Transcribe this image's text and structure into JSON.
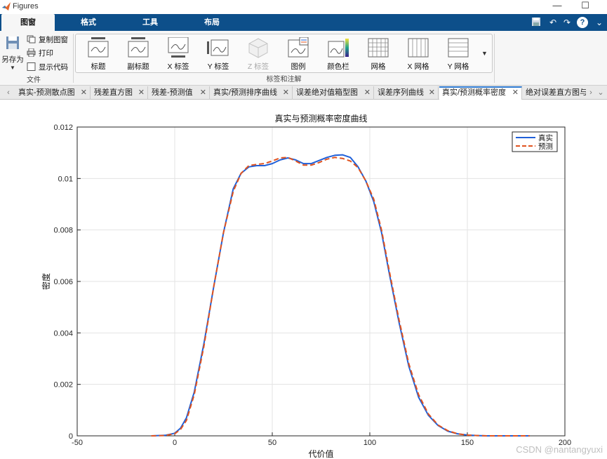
{
  "window": {
    "title": "Figures",
    "minimize": "—",
    "maximize": "☐"
  },
  "ribbon_tabs": [
    "图窗",
    "格式",
    "工具",
    "布局"
  ],
  "active_ribbon_tab": 0,
  "quick_access": [
    "save-icon",
    "undo-icon",
    "redo-icon",
    "help-icon",
    "expand-icon"
  ],
  "file_group": {
    "save_as": "另存为",
    "copy_figure": "复制图窗",
    "print": "打印",
    "show_code": "显示代码",
    "label": "文件"
  },
  "labels_group": {
    "label": "标签和注解",
    "buttons": [
      {
        "label": "标题",
        "icon": "title-icon",
        "enabled": true
      },
      {
        "label": "副标题",
        "icon": "subtitle-icon",
        "enabled": true
      },
      {
        "label": "X 标签",
        "icon": "xlabel-icon",
        "enabled": true
      },
      {
        "label": "Y 标签",
        "icon": "ylabel-icon",
        "enabled": true
      },
      {
        "label": "Z 标签",
        "icon": "zlabel-icon",
        "enabled": false
      },
      {
        "label": "图例",
        "icon": "legend-icon",
        "enabled": true
      },
      {
        "label": "颜色栏",
        "icon": "colorbar-icon",
        "enabled": true
      },
      {
        "label": "网格",
        "icon": "grid-icon",
        "enabled": true
      },
      {
        "label": "X 网格",
        "icon": "xgrid-icon",
        "enabled": true
      },
      {
        "label": "Y 网格",
        "icon": "ygrid-icon",
        "enabled": true
      }
    ]
  },
  "doc_tabs": [
    "真实-预测散点图",
    "残差直方图",
    "残差-预测值",
    "真实/预测排序曲线",
    "误差绝对值箱型图",
    "误差序列曲线",
    "真实/预测概率密度",
    "绝对误差直方图与"
  ],
  "active_doc_tab": 6,
  "watermark": "CSDN @nantangyuxi",
  "colors": {
    "ribbon_blue": "#0d4f8a",
    "series_true": "#2060d8",
    "series_pred": "#e0531f",
    "grid": "#e3e3e3"
  },
  "chart_data": {
    "type": "line",
    "title": "真实与预测概率密度曲线",
    "xlabel": "代价值",
    "ylabel": "密度",
    "xlim": [
      -50,
      200
    ],
    "ylim": [
      0,
      0.012
    ],
    "xticks": [
      -50,
      0,
      50,
      100,
      150,
      200
    ],
    "yticks": [
      0,
      0.002,
      0.004,
      0.006,
      0.008,
      0.01,
      0.012
    ],
    "ytick_labels": [
      "0",
      "0.002",
      "0.004",
      "0.006",
      "0.008",
      "0.01",
      "0.012"
    ],
    "grid": true,
    "legend_position": "top-right",
    "series": [
      {
        "name": "真实",
        "style": "solid",
        "color": "#2060d8",
        "x": [
          -12,
          -5,
          0,
          3,
          6,
          10,
          15,
          20,
          25,
          30,
          34,
          38,
          42,
          46,
          50,
          54,
          58,
          62,
          66,
          70,
          74,
          78,
          82,
          86,
          90,
          94,
          98,
          102,
          106,
          110,
          115,
          120,
          125,
          130,
          135,
          140,
          145,
          150,
          155,
          160,
          170,
          180,
          182
        ],
        "y": [
          0,
          2e-05,
          0.0001,
          0.0003,
          0.0007,
          0.0017,
          0.0036,
          0.0058,
          0.0079,
          0.0096,
          0.0102,
          0.01045,
          0.0105,
          0.0105,
          0.01058,
          0.01072,
          0.0108,
          0.01072,
          0.01058,
          0.01058,
          0.0107,
          0.01082,
          0.0109,
          0.01092,
          0.01082,
          0.01045,
          0.0099,
          0.0091,
          0.0079,
          0.0063,
          0.0044,
          0.0027,
          0.0015,
          0.0008,
          0.0004,
          0.00018,
          8e-05,
          3e-05,
          1e-05,
          0,
          0,
          0,
          0
        ]
      },
      {
        "name": "预测",
        "style": "dashed",
        "color": "#e0531f",
        "x": [
          -12,
          -5,
          0,
          3,
          6,
          10,
          15,
          20,
          25,
          30,
          34,
          38,
          42,
          46,
          50,
          54,
          58,
          62,
          66,
          70,
          74,
          78,
          82,
          86,
          90,
          94,
          98,
          102,
          106,
          110,
          115,
          120,
          125,
          130,
          135,
          140,
          145,
          150,
          155,
          160,
          170,
          180,
          182
        ],
        "y": [
          0,
          1e-05,
          8e-05,
          0.00025,
          0.0006,
          0.0016,
          0.0035,
          0.0058,
          0.0079,
          0.0095,
          0.0102,
          0.0105,
          0.01055,
          0.01058,
          0.01068,
          0.0108,
          0.01082,
          0.01068,
          0.01052,
          0.01052,
          0.01062,
          0.01075,
          0.01082,
          0.01078,
          0.01068,
          0.01042,
          0.0099,
          0.0092,
          0.008,
          0.0064,
          0.0045,
          0.0028,
          0.0016,
          0.00085,
          0.00042,
          0.0002,
          8e-05,
          3e-05,
          1e-05,
          0,
          0,
          0,
          0
        ]
      }
    ]
  }
}
